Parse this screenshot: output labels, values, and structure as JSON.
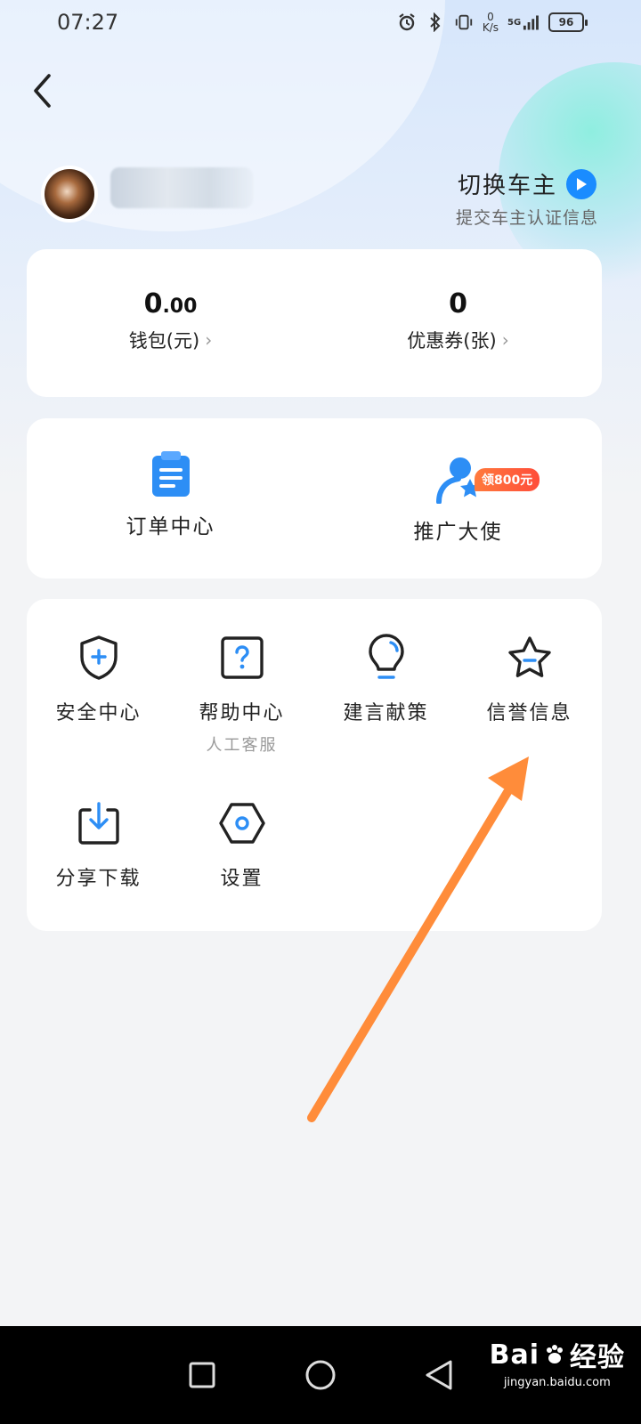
{
  "status_bar": {
    "time": "07:27",
    "net_speed_value": "0",
    "net_speed_unit": "K/s",
    "network": "5G",
    "battery": "96"
  },
  "profile": {
    "switch_owner_label": "切换车主",
    "switch_owner_sub": "提交车主认证信息"
  },
  "stats": [
    {
      "value_int": "0",
      "value_dec": ".00",
      "label": "钱包(元)"
    },
    {
      "value_int": "0",
      "value_dec": "",
      "label": "优惠券(张)"
    }
  ],
  "features": [
    {
      "label": "订单中心",
      "icon": "clipboard-icon"
    },
    {
      "label": "推广大使",
      "icon": "ambassador-icon",
      "badge": "领800元"
    }
  ],
  "tools": [
    {
      "label": "安全中心",
      "icon": "shield-plus-icon"
    },
    {
      "label": "帮助中心",
      "sub": "人工客服",
      "icon": "question-box-icon"
    },
    {
      "label": "建言献策",
      "icon": "lightbulb-icon"
    },
    {
      "label": "信誉信息",
      "icon": "star-icon"
    },
    {
      "label": "分享下载",
      "icon": "download-box-icon"
    },
    {
      "label": "设置",
      "icon": "hexagon-settings-icon"
    }
  ],
  "annotation": {
    "color": "#ff8c3a"
  },
  "watermark": {
    "brand": "Bai",
    "brand_suffix": "经验",
    "url": "jingyan.baidu.com"
  },
  "colors": {
    "accent": "#1a8cff",
    "badge": "#ff5a3a"
  }
}
